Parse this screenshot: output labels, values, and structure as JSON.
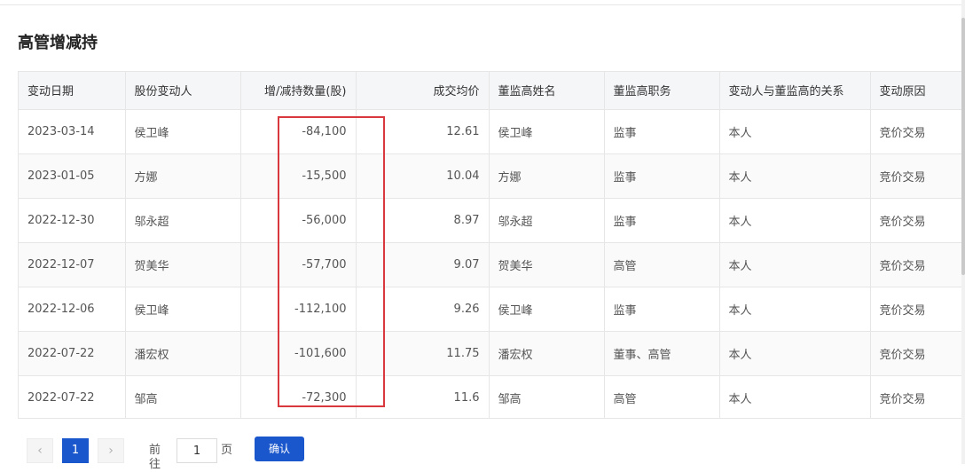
{
  "section": {
    "title": "高管增减持"
  },
  "table": {
    "headers": [
      "变动日期",
      "股份变动人",
      "增/减持数量(股)",
      "成交均价",
      "董监高姓名",
      "董监高职务",
      "变动人与董监高的关系",
      "变动原因"
    ],
    "rows": [
      [
        "2023-03-14",
        "侯卫峰",
        "-84,100",
        "12.61",
        "侯卫峰",
        "监事",
        "本人",
        "竞价交易"
      ],
      [
        "2023-01-05",
        "方娜",
        "-15,500",
        "10.04",
        "方娜",
        "监事",
        "本人",
        "竞价交易"
      ],
      [
        "2022-12-30",
        "邬永超",
        "-56,000",
        "8.97",
        "邬永超",
        "监事",
        "本人",
        "竞价交易"
      ],
      [
        "2022-12-07",
        "贺美华",
        "-57,700",
        "9.07",
        "贺美华",
        "高管",
        "本人",
        "竞价交易"
      ],
      [
        "2022-12-06",
        "侯卫峰",
        "-112,100",
        "9.26",
        "侯卫峰",
        "监事",
        "本人",
        "竞价交易"
      ],
      [
        "2022-07-22",
        "潘宏权",
        "-101,600",
        "11.75",
        "潘宏权",
        "董事、高管",
        "本人",
        "竞价交易"
      ],
      [
        "2022-07-22",
        "邹高",
        "-72,300",
        "11.6",
        "邹高",
        "高管",
        "本人",
        "竞价交易"
      ]
    ]
  },
  "pagination": {
    "prev_icon": "‹",
    "next_icon": "›",
    "current_page": "1",
    "goto_label": "前往",
    "goto_value": "1",
    "page_unit": "页",
    "confirm_label": "确认"
  },
  "colors": {
    "accent": "#1a56cc",
    "highlight_box": "#d9393e",
    "header_bg": "#f5f6f8"
  }
}
